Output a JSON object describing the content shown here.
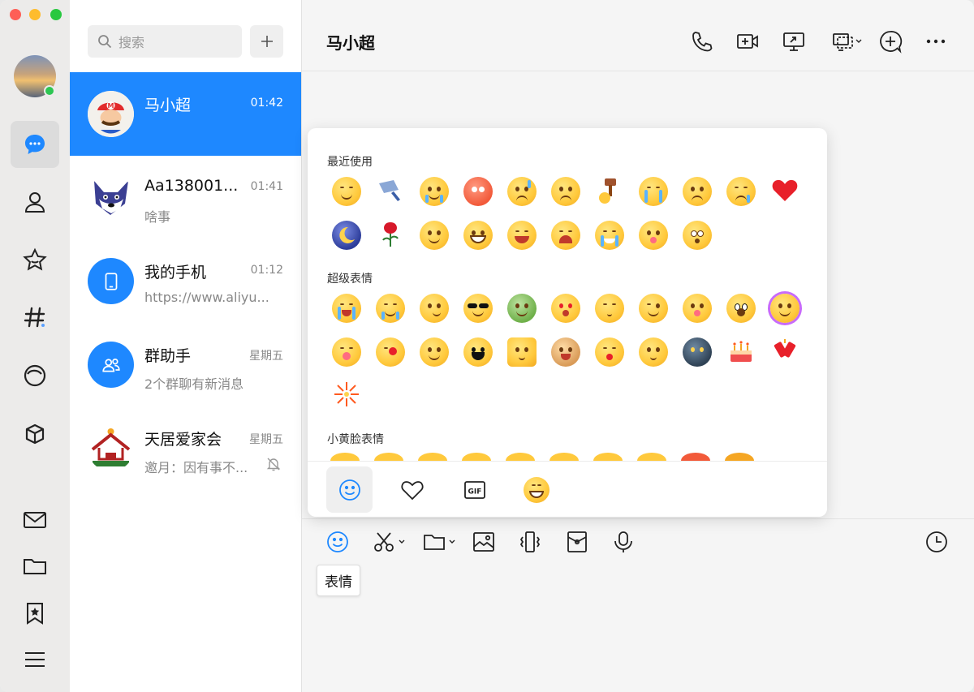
{
  "sidebar": {
    "nav_items": [
      "chat",
      "contacts",
      "favorites",
      "topics",
      "moments",
      "workspace",
      "mail",
      "files",
      "bookmarks",
      "menu"
    ]
  },
  "conversation_list": {
    "search_placeholder": "搜索",
    "items": [
      {
        "name": "马小超",
        "time": "01:42",
        "preview": "",
        "active": true
      },
      {
        "name": "Aa138001...",
        "time": "01:41",
        "preview": "啥事",
        "active": false
      },
      {
        "name": "我的手机",
        "time": "01:12",
        "preview": "https://www.aliyu...",
        "active": false
      },
      {
        "name": "群助手",
        "time": "星期五",
        "preview": "2个群聊有新消息",
        "active": false
      },
      {
        "name": "天居爱家会",
        "time": "星期五",
        "preview": "邀月：因有事不...",
        "active": false,
        "muted": true
      }
    ]
  },
  "chat": {
    "title": "马小超",
    "header_actions": [
      "phone-icon",
      "video-call-icon",
      "screen-share-icon",
      "remote-desktop-icon",
      "add-member-icon",
      "more-icon"
    ],
    "toolbar": [
      "emoji-icon",
      "screenshot-icon",
      "folder-icon",
      "image-icon",
      "vibrate-icon",
      "red-packet-icon",
      "microphone-icon",
      "history-icon"
    ],
    "tooltip": "表情"
  },
  "emoji_panel": {
    "sections": [
      {
        "title": "最近使用"
      },
      {
        "title": "超级表情"
      },
      {
        "title": "小黄脸表情"
      }
    ],
    "tabs": [
      "smile-tab",
      "favorite-tab",
      "gif-tab",
      "grin-tab"
    ]
  },
  "colors": {
    "accent": "#1e88ff",
    "online": "#2dc653"
  }
}
